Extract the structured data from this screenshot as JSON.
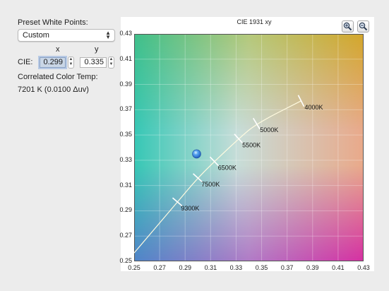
{
  "sidebar": {
    "preset_label": "Preset White Points:",
    "preset_value": "Custom",
    "col_x": "x",
    "col_y": "y",
    "cie_label": "CIE:",
    "cie_x_value": "0.299",
    "cie_y_value": "0.335",
    "cct_label": "Correlated Color Temp:",
    "cct_value": "7201 K (0.0100 Δuv)"
  },
  "chart": {
    "title": "CIE 1931 xy",
    "zoom_in_icon": "zoom-in-icon",
    "zoom_out_icon": "zoom-out-icon",
    "cursor_icon": "white-point-marker-icon"
  },
  "chart_data": {
    "type": "scatter",
    "title": "CIE 1931 xy",
    "xlim": [
      0.25,
      0.43
    ],
    "ylim": [
      0.25,
      0.43
    ],
    "x_ticks": [
      "0.25",
      "0.27",
      "0.29",
      "0.31",
      "0.33",
      "0.35",
      "0.37",
      "0.39",
      "0.41",
      "0.43"
    ],
    "y_ticks": [
      "0.25",
      "0.27",
      "0.29",
      "0.31",
      "0.33",
      "0.35",
      "0.37",
      "0.39",
      "0.41",
      "0.43"
    ],
    "grid": true,
    "planckian_locus": [
      {
        "label": "9300K",
        "x": 0.284,
        "y": 0.297
      },
      {
        "label": "7500K",
        "x": 0.3,
        "y": 0.316
      },
      {
        "label": "6500K",
        "x": 0.313,
        "y": 0.329
      },
      {
        "label": "5500K",
        "x": 0.332,
        "y": 0.347
      },
      {
        "label": "5000K",
        "x": 0.346,
        "y": 0.359
      },
      {
        "label": "4000K",
        "x": 0.381,
        "y": 0.377
      }
    ],
    "white_point": {
      "x": 0.299,
      "y": 0.335
    }
  }
}
